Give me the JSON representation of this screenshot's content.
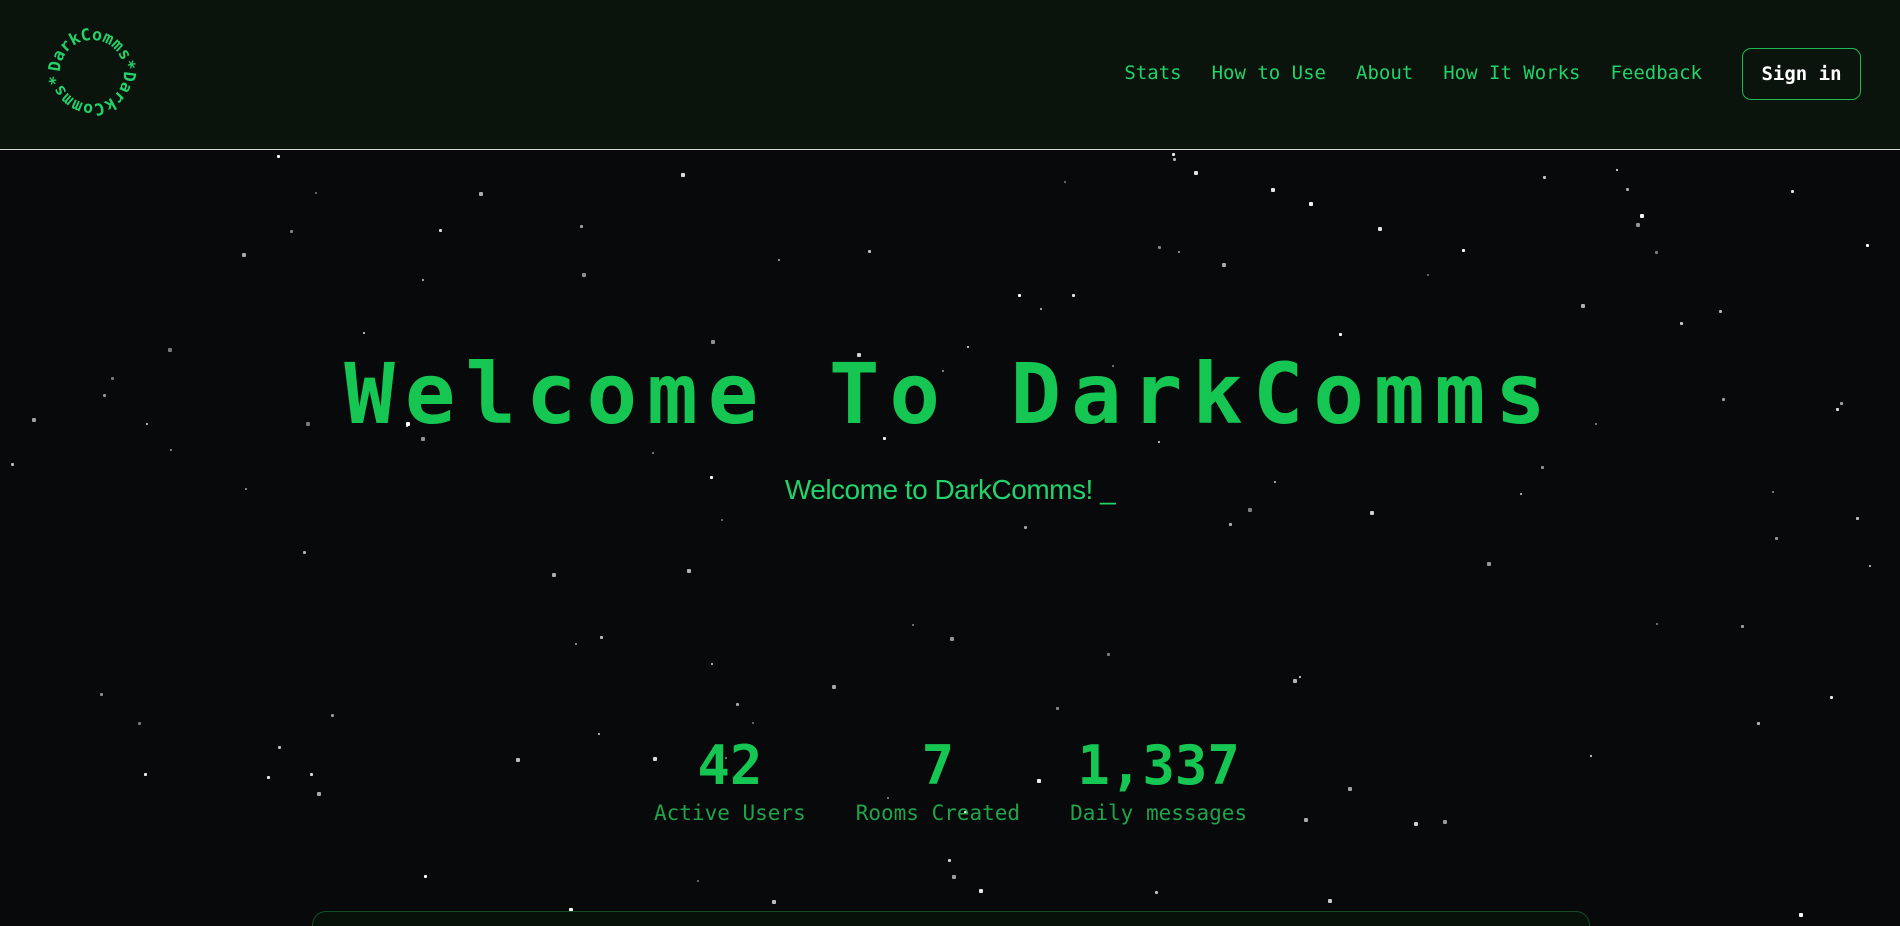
{
  "logo": {
    "ring_text": "DarkComms*DarkComms*",
    "icon": "circular-text-logo"
  },
  "nav": {
    "links": [
      "Stats",
      "How to Use",
      "About",
      "How It Works",
      "Feedback"
    ],
    "signin_label": "Sign in"
  },
  "hero": {
    "title": "Welcome To DarkComms",
    "subtitle": "Welcome to DarkComms!",
    "cursor": "_"
  },
  "stats": [
    {
      "value": "42",
      "label": "Active Users"
    },
    {
      "value": "7",
      "label": "Rooms Created"
    },
    {
      "value": "1,337",
      "label": "Daily messages"
    }
  ],
  "colors": {
    "accent": "#16c653",
    "nav_background": "#0a130c",
    "page_background": "#07090a"
  }
}
